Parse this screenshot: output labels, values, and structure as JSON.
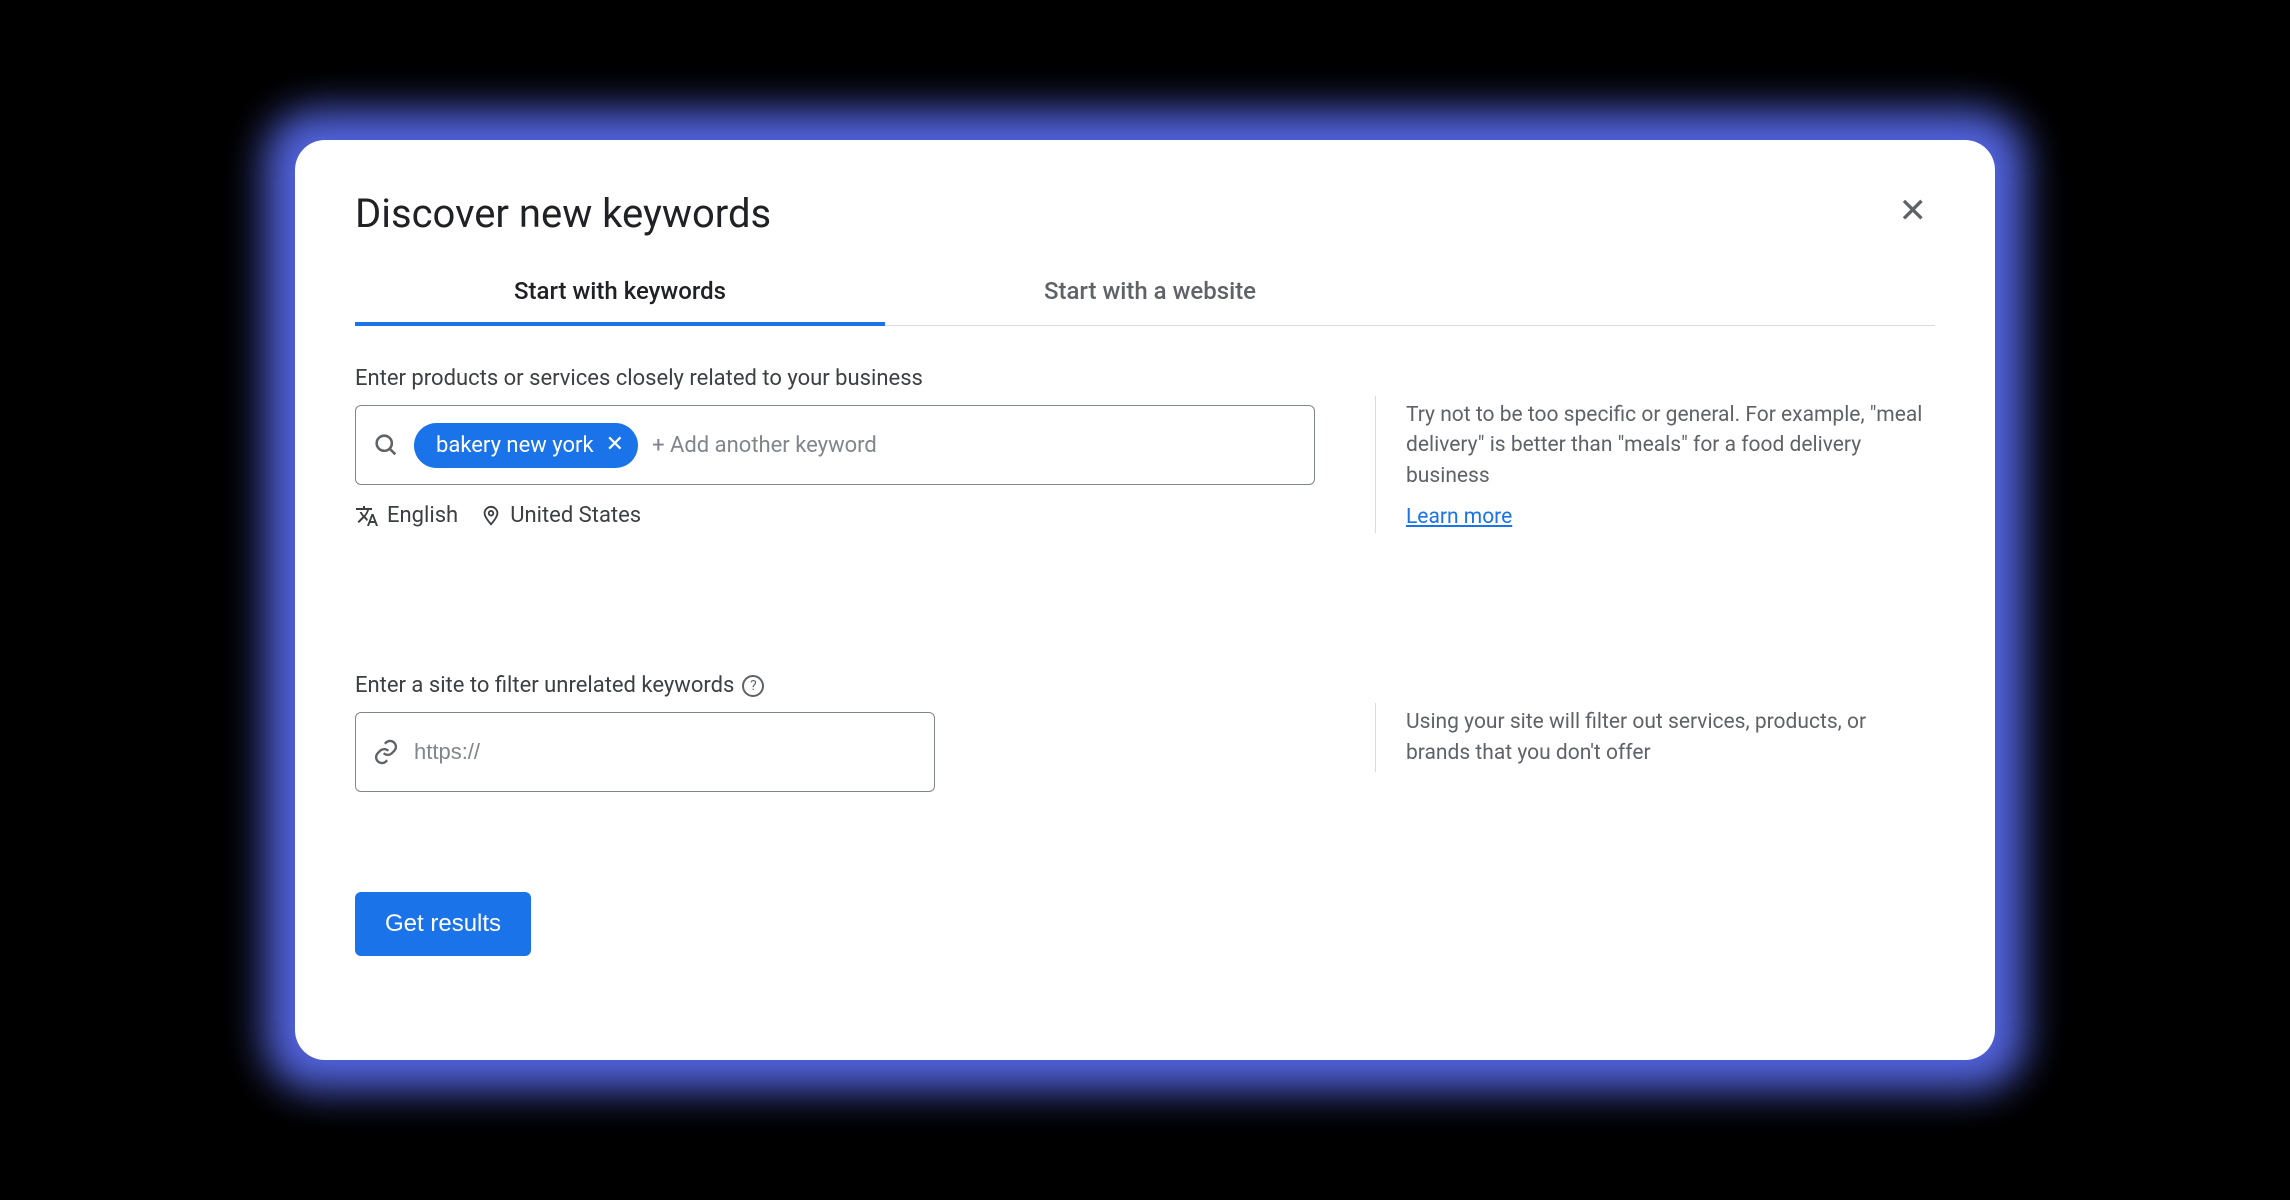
{
  "dialog": {
    "title": "Discover new keywords",
    "tabs": [
      {
        "label": "Start with keywords",
        "active": true
      },
      {
        "label": "Start with a website",
        "active": false
      }
    ]
  },
  "keywords_section": {
    "label": "Enter products or services closely related to your business",
    "chip": "bakery new york",
    "add_placeholder": "+ Add another keyword",
    "language": "English",
    "location": "United States",
    "tip": "Try not to be too specific or general. For example, \"meal delivery\" is better than \"meals\" for a food delivery business",
    "learn_more": "Learn more"
  },
  "site_section": {
    "label": "Enter a site to filter unrelated keywords",
    "placeholder": "https://",
    "tip": "Using your site will filter out services, products, or brands that you don't offer"
  },
  "actions": {
    "submit": "Get results"
  }
}
